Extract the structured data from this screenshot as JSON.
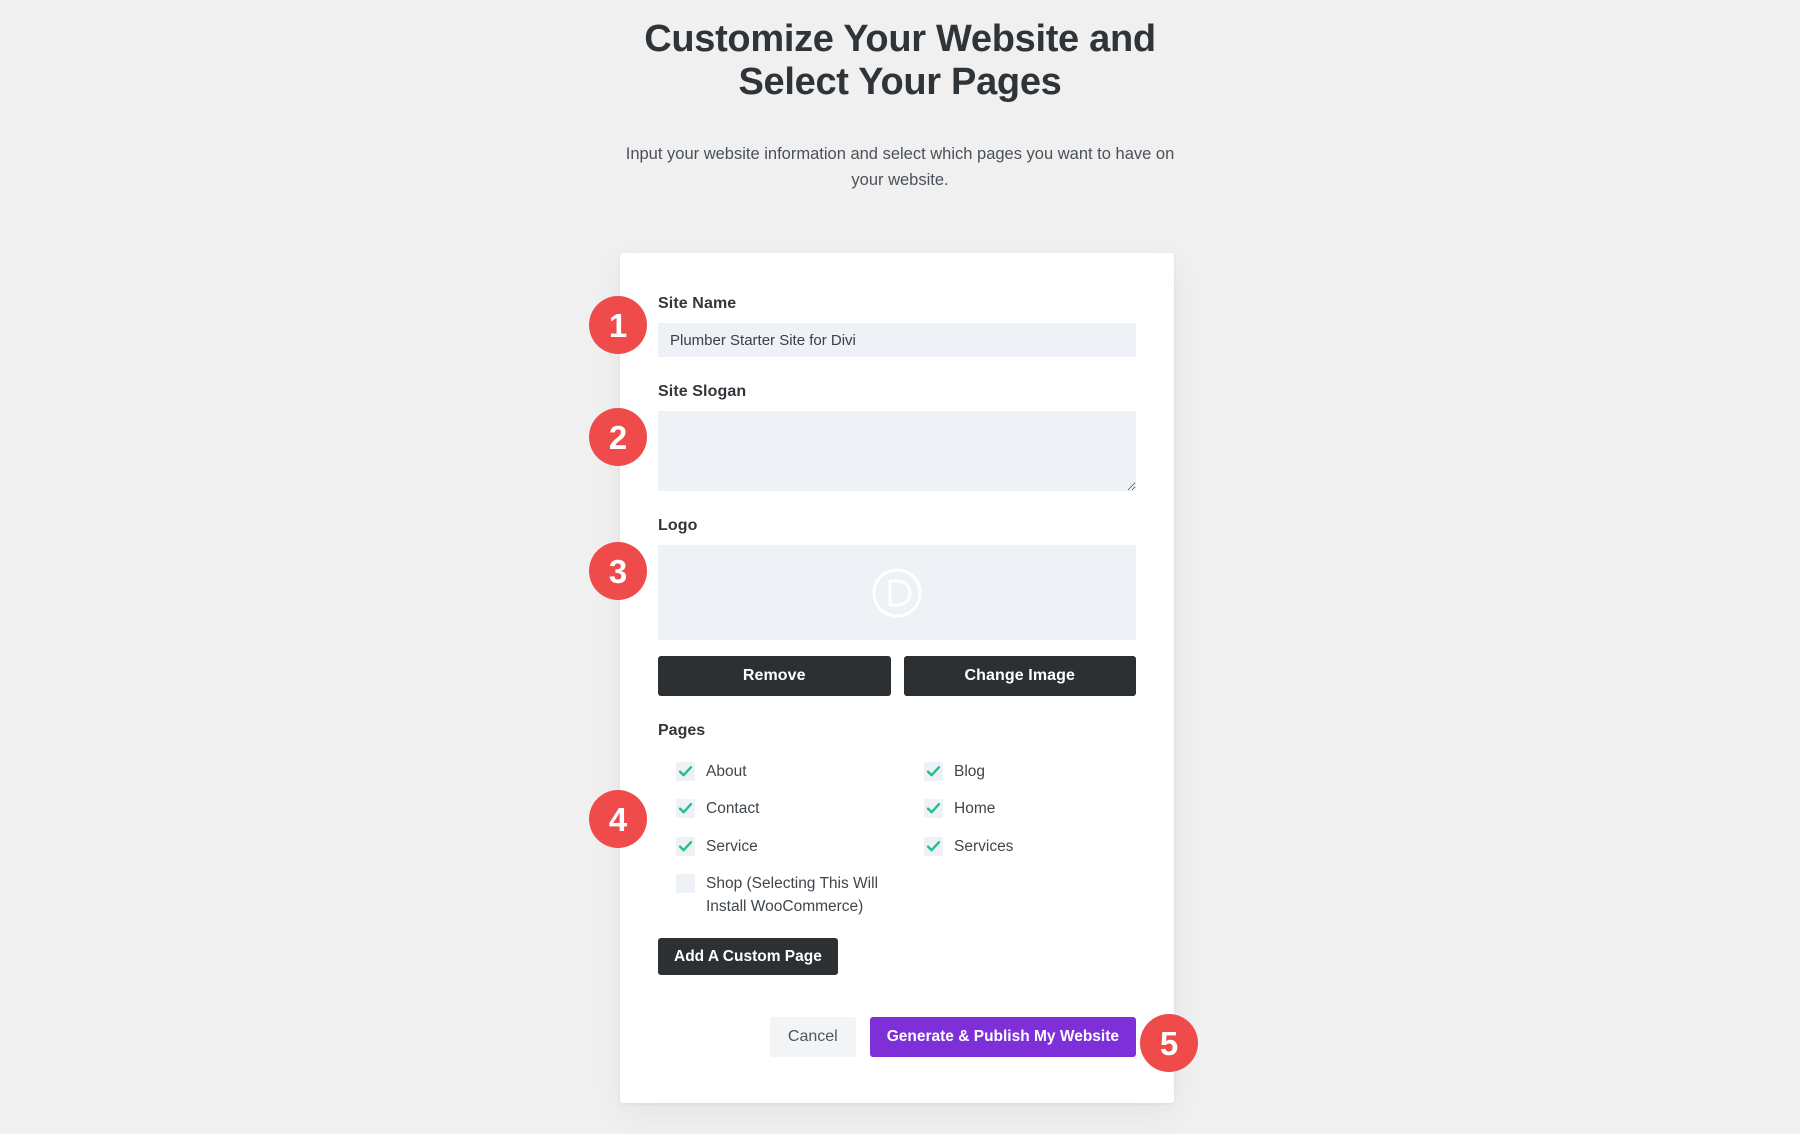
{
  "header": {
    "title": "Customize Your Website and Select Your Pages",
    "subtitle": "Input your website information and select which pages you want to have on your website."
  },
  "colors": {
    "page_background": "#f0f0f1",
    "card_background": "#ffffff",
    "input_background": "#eef1f6",
    "dark_button": "#2c3033",
    "primary_button": "#7f2fd8",
    "badge_red": "#ef4b4b",
    "check_teal": "#21c08c",
    "heading_text": "#2f3439"
  },
  "form": {
    "site_name": {
      "label": "Site Name",
      "value": "Plumber Starter Site for Divi",
      "placeholder": ""
    },
    "site_slogan": {
      "label": "Site Slogan",
      "value": "",
      "placeholder": ""
    },
    "logo": {
      "label": "Logo",
      "icon": "divi-d-logo-icon",
      "remove_label": "Remove",
      "change_label": "Change Image"
    }
  },
  "pages": {
    "label": "Pages",
    "options": [
      {
        "label": "About",
        "checked": true
      },
      {
        "label": "Blog",
        "checked": true
      },
      {
        "label": "Contact",
        "checked": true
      },
      {
        "label": "Home",
        "checked": true
      },
      {
        "label": "Service",
        "checked": true
      },
      {
        "label": "Services",
        "checked": true
      },
      {
        "label": "Shop (Selecting This Will Install WooCommerce)",
        "checked": false
      }
    ],
    "add_custom_page_label": "Add A Custom Page"
  },
  "footer": {
    "cancel_label": "Cancel",
    "generate_label": "Generate & Publish My Website"
  },
  "badges": [
    {
      "number": "1"
    },
    {
      "number": "2"
    },
    {
      "number": "3"
    },
    {
      "number": "4"
    },
    {
      "number": "5"
    }
  ]
}
